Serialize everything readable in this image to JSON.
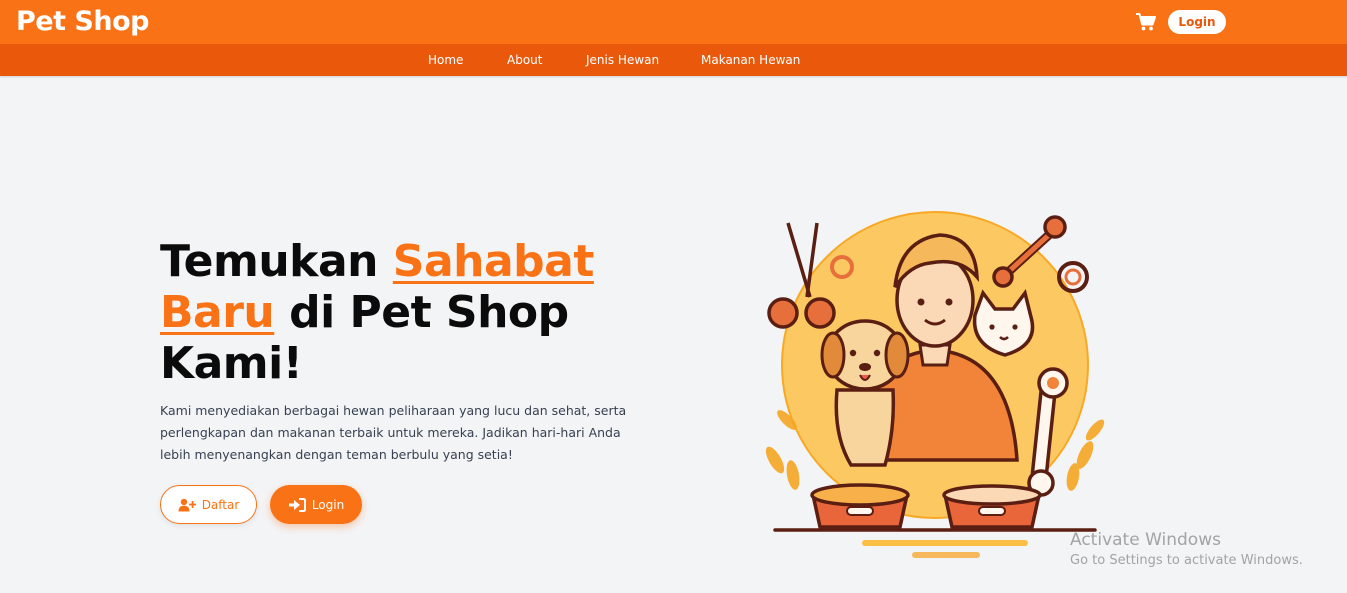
{
  "header": {
    "brand": "Pet Shop",
    "cart_icon": "shopping-cart-icon",
    "login_label": "Login"
  },
  "nav": {
    "items": [
      {
        "label": "Home"
      },
      {
        "label": "About"
      },
      {
        "label": "Jenis Hewan"
      },
      {
        "label": "Makanan Hewan"
      }
    ]
  },
  "hero": {
    "title_part1": "Temukan ",
    "title_accent": "Sahabat Baru",
    "title_part2": " di Pet Shop Kami!",
    "description": "Kami menyediakan berbagai hewan peliharaan yang lucu dan sehat, serta perlengkapan dan makanan terbaik untuk mereka. Jadikan hari-hari Anda lebih menyenangkan dengan teman berbulu yang setia!",
    "daftar_label": "Daftar",
    "daftar_icon": "user-plus-icon",
    "login_label": "Login",
    "login_icon": "sign-in-icon"
  },
  "watermark": {
    "line1": "Activate Windows",
    "line2": "Go to Settings to activate Windows."
  },
  "colors": {
    "primary": "#f97316",
    "primary_dark": "#ea580c",
    "background": "#f3f4f6",
    "text": "#0b0b0b"
  }
}
